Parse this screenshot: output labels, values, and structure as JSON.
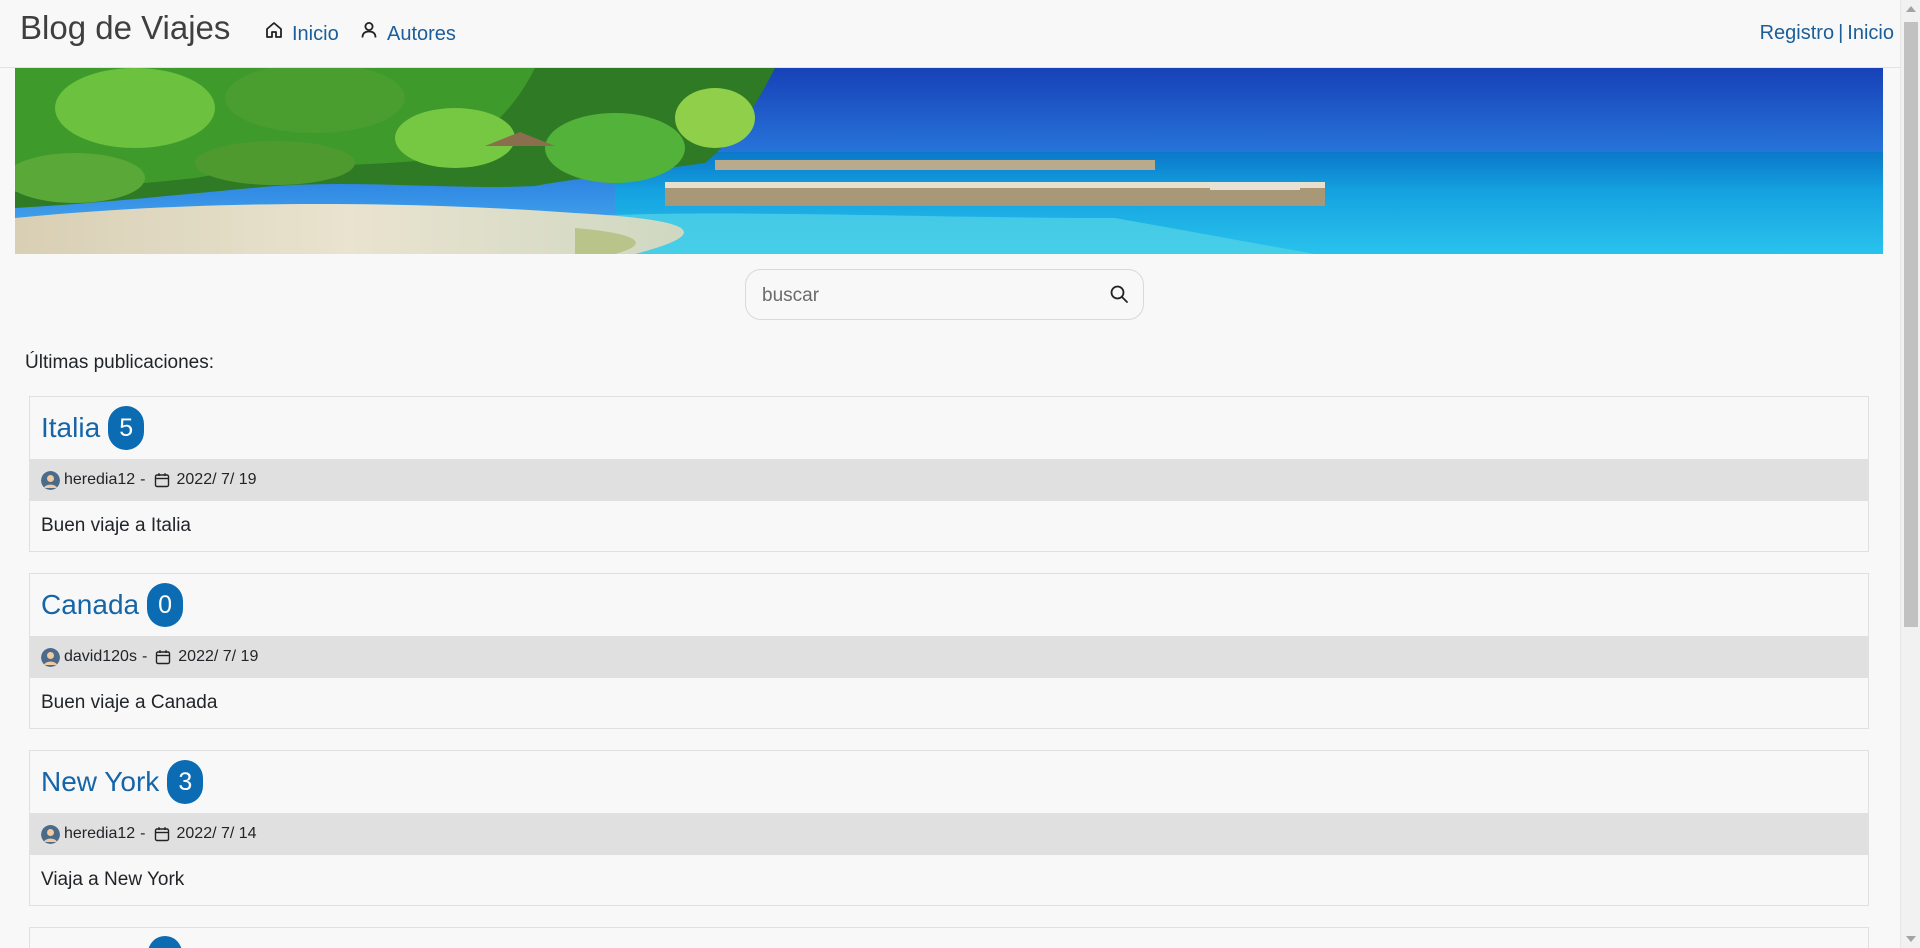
{
  "navbar": {
    "brand": "Blog de Viajes",
    "links": [
      {
        "label": "Inicio",
        "icon": "home-icon"
      },
      {
        "label": "Autores",
        "icon": "user-icon"
      }
    ],
    "auth": {
      "register": "Registro",
      "separator": "|",
      "login": "Inicio"
    }
  },
  "banner": {
    "image": "beach-banner-image"
  },
  "search": {
    "placeholder": "buscar",
    "value": "",
    "icon": "search-icon"
  },
  "section_label": "Últimas publicaciones:",
  "posts": [
    {
      "title": "Italia",
      "count": "5",
      "author": "heredia12",
      "separator": "-",
      "date": "2022/ 7/ 19",
      "body": "Buen viaje a Italia"
    },
    {
      "title": "Canada",
      "count": "0",
      "author": "david120s",
      "separator": "-",
      "date": "2022/ 7/ 19",
      "body": "Buen viaje a Canada"
    },
    {
      "title": "New York",
      "count": "3",
      "author": "heredia12",
      "separator": "-",
      "date": "2022/ 7/ 14",
      "body": "Viaja a New York"
    }
  ],
  "colors": {
    "link": "#1b5e9a",
    "badge": "#0b6cb3",
    "meta_bg": "#e0e0e0",
    "page_bg": "#f8f8f8"
  }
}
